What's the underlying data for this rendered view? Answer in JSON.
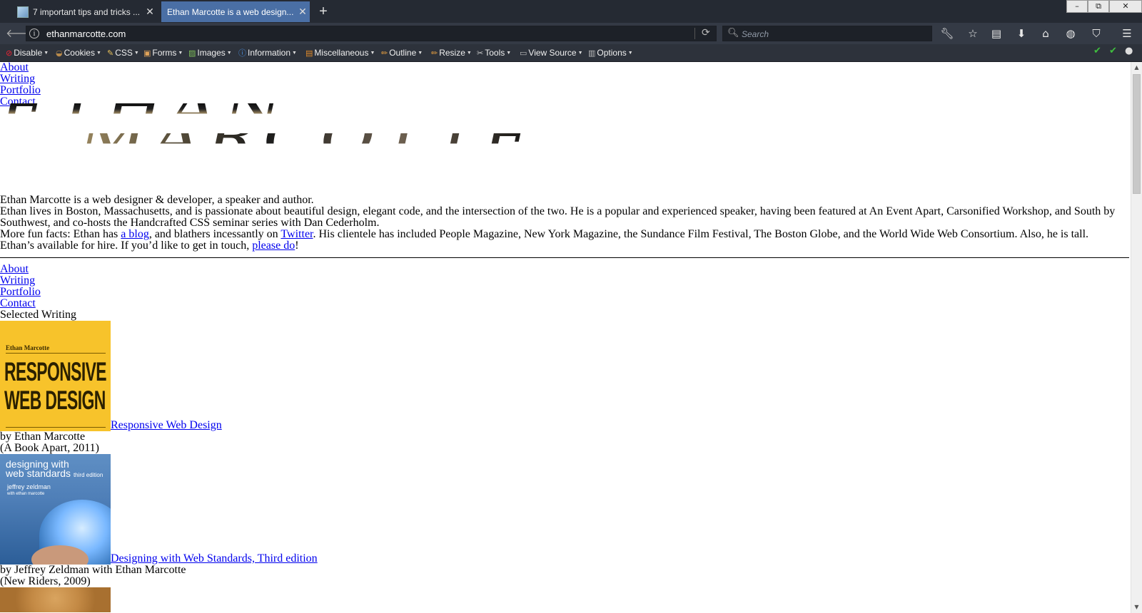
{
  "browser": {
    "tabs": [
      {
        "label": "7 important tips and tricks ...",
        "active": false
      },
      {
        "label": "Ethan Marcotte is a web design...",
        "active": true
      }
    ],
    "url": "ethanmarcotte.com",
    "search_placeholder": "Search",
    "new_tab": "+",
    "win_minimize": "–",
    "win_restore": "⧉",
    "win_close": "✕"
  },
  "devtoolbar": {
    "items": [
      "Disable",
      "Cookies",
      "CSS",
      "Forms",
      "Images",
      "Information",
      "Miscellaneous",
      "Outline",
      "Resize",
      "Tools",
      "View Source",
      "Options"
    ]
  },
  "page": {
    "nav": [
      "About",
      "Writing",
      "Portfolio",
      "Contact"
    ],
    "logo": {
      "line1": "ETHAN",
      "line2": "MARCOTTE"
    },
    "intro": "Ethan Marcotte is a web designer & developer, a speaker and author.",
    "bio_p2": "Ethan lives in Boston, Massachusetts, and is passionate about beautiful design, elegant code, and the intersection of the two. He is a popular and experienced speaker, having been featured at An Event Apart, Carsonified Workshop, and South by Southwest, and co-hosts the Handcrafted CSS seminar series with Dan Cederholm.",
    "bio_p3": {
      "before": "More fun facts: Ethan has ",
      "link1": "a blog",
      "middle": ", and blathers incessantly on ",
      "link2": "Twitter",
      "after": ". His clientele has included People Magazine, New York Magazine, the Sundance Film Festival, The Boston Globe, and the World Wide Web Consortium. Also, he is tall."
    },
    "bio_p4": {
      "before": "Ethan’s available for hire. If you’d like to get in touch, ",
      "link": "please do",
      "after": "!"
    },
    "nav2": [
      "About",
      "Writing",
      "Portfolio",
      "Contact"
    ],
    "section_title": "Selected Writing",
    "books": [
      {
        "title": "Responsive Web Design",
        "byline": "by Ethan Marcotte",
        "publisher": "(A Book Apart, 2011)",
        "cover_author": "Ethan Marcotte",
        "cover_title_1": "RESPONSIVE",
        "cover_title_2": "WEB DESIGN"
      },
      {
        "title": "Designing with Web Standards, Third edition",
        "byline": "by Jeffrey Zeldman with Ethan Marcotte",
        "publisher": "(New Riders, 2009)",
        "cover_title_1": "designing with",
        "cover_title_2": "web standards",
        "cover_edition": "third edition",
        "cover_author": "jeffrey zeldman",
        "cover_coauthor": "with ethan marcotte"
      }
    ]
  },
  "colors": {
    "tab_bar": "#252a33",
    "nav_bar": "#343a45",
    "active_tab": "#4a6fa5",
    "link": "#0000ee",
    "status_green": "#3fbf3f"
  }
}
